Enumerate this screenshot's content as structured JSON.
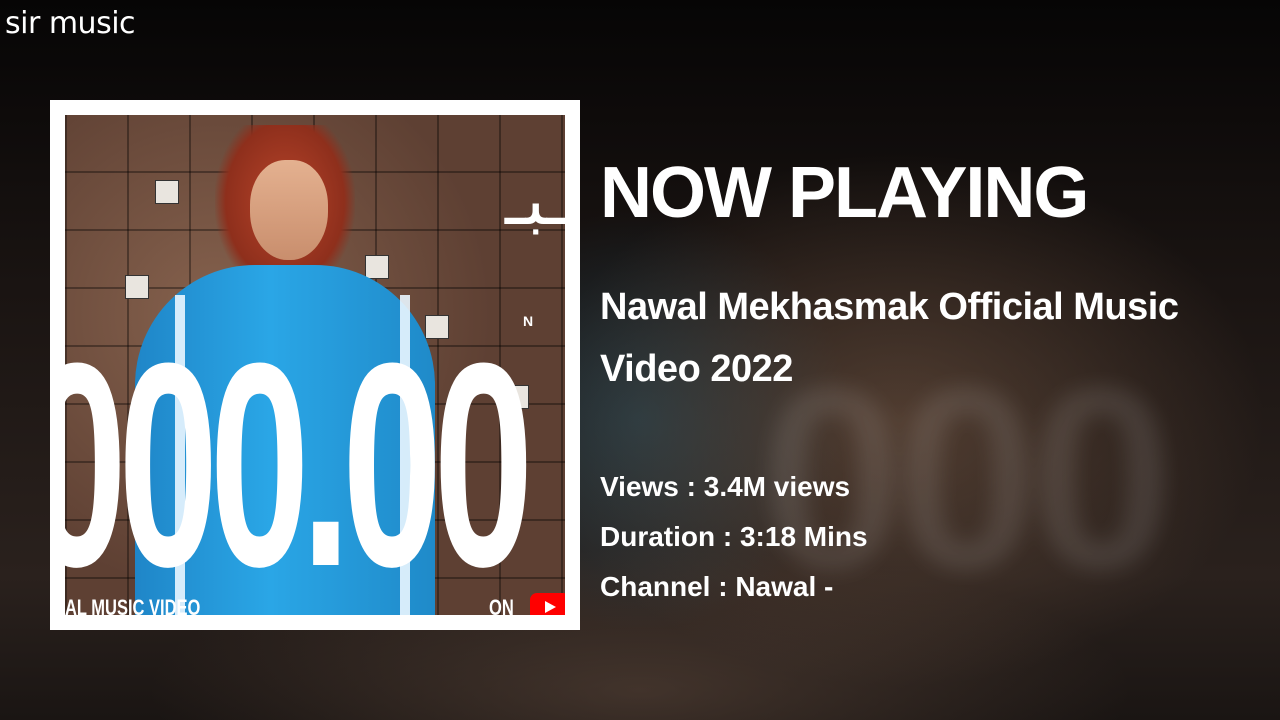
{
  "app": {
    "brand": "sir music"
  },
  "cover": {
    "big_number": "000.00",
    "bottom_text": "AL MUSIC VIDEO",
    "bottom_on": "ON",
    "letter": "N"
  },
  "now_playing": {
    "heading": "NOW PLAYING",
    "title": "Nawal Mekhasmak Official Music Video 2022",
    "views_label": "Views : 3.4M views",
    "duration_label": "Duration : 3:18 Mins",
    "channel_label": "Channel : Nawal -"
  },
  "colors": {
    "text": "#ffffff",
    "frame": "#ffffff",
    "background": "#0b0908",
    "youtube": "#ff0000",
    "jacket": "#2aa6e6"
  }
}
